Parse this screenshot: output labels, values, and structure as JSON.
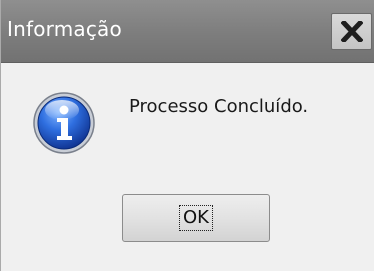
{
  "window": {
    "title": "Informação",
    "close_icon": "close-x-icon"
  },
  "dialog": {
    "icon": "information-icon",
    "message": "Processo Concluído.",
    "ok_label": "OK"
  },
  "colors": {
    "titlebar": "#7d7d7d",
    "title_text": "#ffffff",
    "dialog_background": "#f0f0f0",
    "info_icon_blue": "#1f5fd1"
  }
}
